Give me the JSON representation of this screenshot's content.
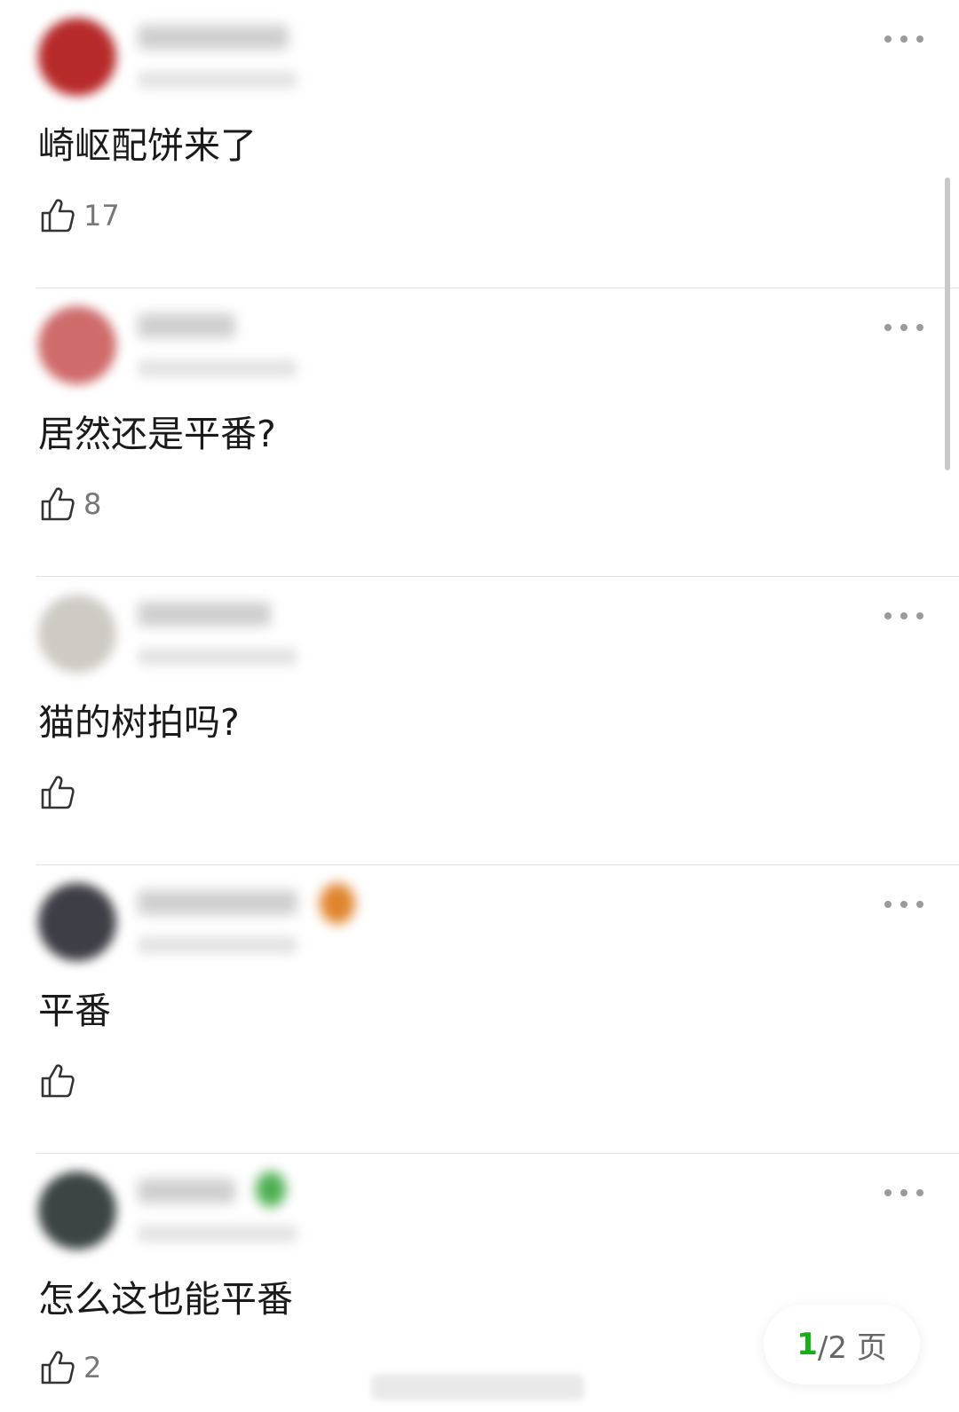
{
  "comments": [
    {
      "text": "崎岖配饼来了",
      "likes": "17",
      "avatar_color": "#b72a2a",
      "name_blur_width": 170
    },
    {
      "text": "居然还是平番?",
      "likes": "8",
      "avatar_color": "#cf6b6b",
      "name_blur_width": 110
    },
    {
      "text": "猫的树拍吗?",
      "likes": "",
      "avatar_color": "#cfcac4",
      "name_blur_width": 150
    },
    {
      "text": "平番",
      "likes": "",
      "avatar_color": "#3e3e46",
      "name_blur_width": 180
    },
    {
      "text": "怎么这也能平番",
      "likes": "2",
      "avatar_color": "#3c4444",
      "name_blur_width": 110
    }
  ],
  "pager": {
    "current": "1",
    "separator": "/2 页"
  },
  "icons": {
    "like": "thumbs-up-icon",
    "more": "more-dots-icon"
  },
  "colors": {
    "accent": "#1aad19",
    "badge_orange": "#e0842c",
    "badge_green": "#4caf50"
  }
}
